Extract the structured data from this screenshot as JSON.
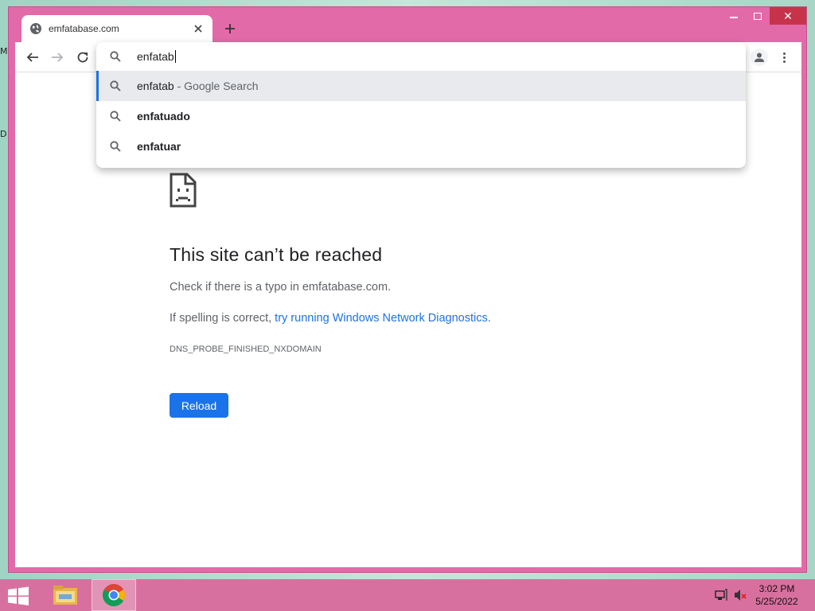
{
  "browser": {
    "tab_title": "emfatabase.com",
    "controls": {
      "minimize": "minimize",
      "maximize": "maximize",
      "close": "✕"
    }
  },
  "omnibox": {
    "input_value": "enfatab",
    "suggestions": [
      {
        "text": "enfatab",
        "suffix": " - Google Search",
        "selected": true
      },
      {
        "text": "enfatuado",
        "suffix": "",
        "selected": false
      },
      {
        "text": "enfatuar",
        "suffix": "",
        "selected": false
      }
    ]
  },
  "error_page": {
    "title": "This site can’t be reached",
    "line1": "Check if there is a typo in emfatabase.com.",
    "line2_prefix": "If spelling is correct, ",
    "line2_link": "try running Windows Network Diagnostics",
    "line2_suffix": ".",
    "error_code": "DNS_PROBE_FINISHED_NXDOMAIN",
    "reload_label": "Reload"
  },
  "taskbar": {
    "time": "3:02 PM",
    "date": "5/25/2022"
  },
  "desktop": {
    "fragment1": "M",
    "fragment2": "D"
  },
  "colors": {
    "window_frame": "#e36aa9",
    "taskbar": "#d8709f",
    "accent": "#1a73e8"
  },
  "icons": [
    "globe-icon",
    "close-icon",
    "plus-icon",
    "back-icon",
    "forward-icon",
    "reload-icon",
    "search-icon",
    "profile-icon",
    "menu-icon",
    "sad-document-icon",
    "windows-start-icon",
    "file-explorer-icon",
    "chrome-icon",
    "network-icon",
    "volume-muted-icon"
  ]
}
